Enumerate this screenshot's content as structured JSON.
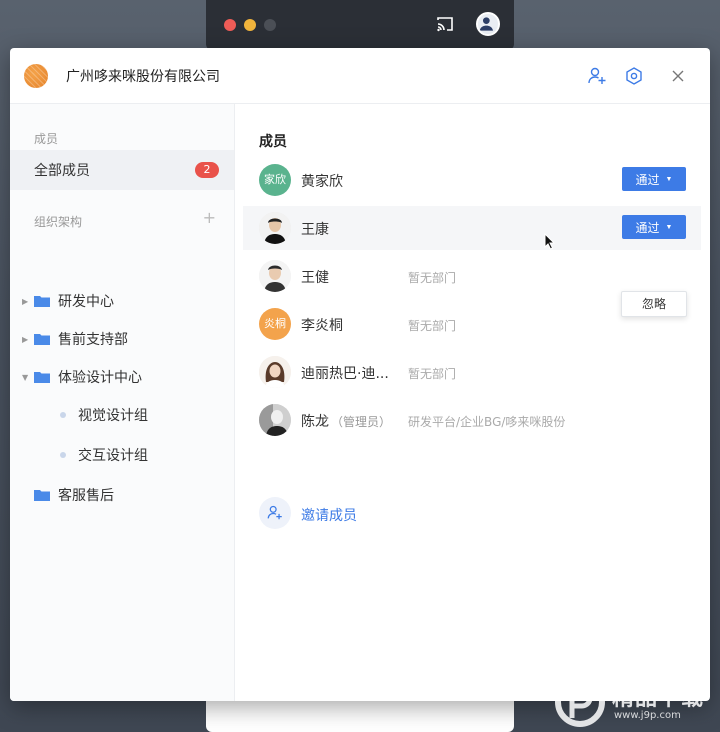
{
  "header": {
    "org_name": "广州哆来咪股份有限公司",
    "icons": [
      "add-user-icon",
      "settings-icon",
      "close-icon"
    ]
  },
  "sidebar": {
    "members_section": "成员",
    "all_members": {
      "label": "全部成员",
      "badge": "2"
    },
    "org_section": "组织架构",
    "add_symbol": "+",
    "tree": [
      {
        "label": "研发中心",
        "expanded": false
      },
      {
        "label": "售前支持部",
        "expanded": false
      },
      {
        "label": "体验设计中心",
        "expanded": true,
        "children": [
          {
            "label": "视觉设计组"
          },
          {
            "label": "交互设计组"
          }
        ]
      },
      {
        "label": "客服售后",
        "expanded": false
      }
    ]
  },
  "main": {
    "title": "成员",
    "members": [
      {
        "name": "黄家欣",
        "avatar_text": "家欣",
        "avatar_color": "#5ab38e",
        "dept": "",
        "action": "通过"
      },
      {
        "name": "王康",
        "avatar_text": "",
        "dept": "",
        "action": "通过"
      },
      {
        "name": "王健",
        "avatar_text": "",
        "dept": "暂无部门"
      },
      {
        "name": "李炎桐",
        "avatar_text": "炎桐",
        "avatar_color": "#f3a34c",
        "dept": "暂无部门"
      },
      {
        "name": "迪丽热巴·迪...",
        "avatar_text": "",
        "dept": "暂无部门"
      },
      {
        "name": "陈龙",
        "role": "（管理员）",
        "avatar_text": "",
        "dept": "研发平台/企业BG/哆来咪股份"
      }
    ],
    "dropdown_option": "忽略",
    "invite_label": "邀请成员"
  },
  "watermark": {
    "text": "精品下载",
    "url": "www.j9p.com"
  },
  "colors": {
    "accent": "#3d7be6",
    "badge": "#e9524a"
  }
}
